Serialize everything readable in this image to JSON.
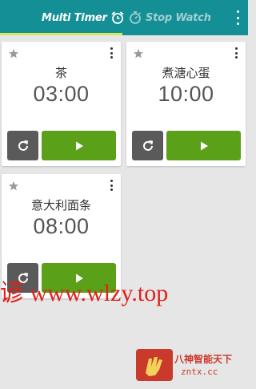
{
  "colors": {
    "appbar": "#148f95",
    "tab_indicator": "#d9e55a",
    "play_button": "#5aa019",
    "reset_button": "#5a5a5a",
    "watermark": "#e0201a"
  },
  "tabs": [
    {
      "label": "Multi Timer",
      "icon": "alarm-clock-icon",
      "selected": true
    },
    {
      "label": "Stop Watch",
      "icon": "stopwatch-icon",
      "selected": false
    }
  ],
  "timers": [
    {
      "name": "茶",
      "time": "03:00"
    },
    {
      "name": "煮溏心蛋",
      "time": "10:00"
    },
    {
      "name": "意大利面条",
      "time": "08:00"
    }
  ],
  "watermark": {
    "text": "谚 www.wlzy.top",
    "logo_text": "八神智能天下",
    "logo_sub": "zntx.cc"
  }
}
